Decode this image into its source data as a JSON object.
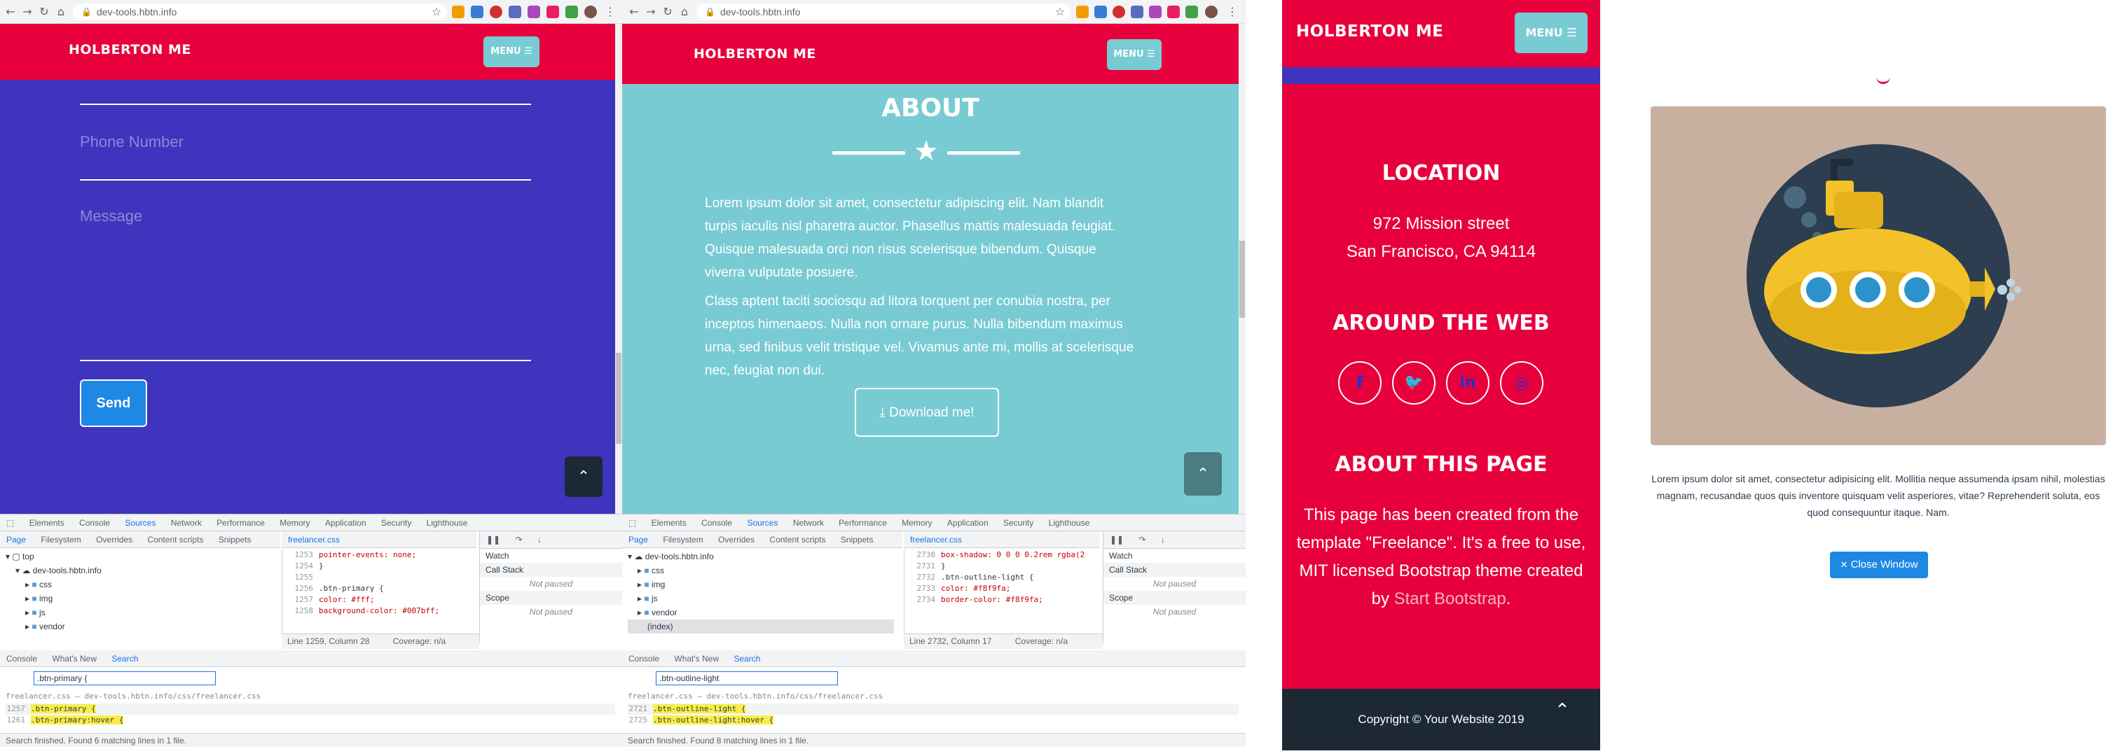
{
  "colors": {
    "red": "#e8003d",
    "indigo": "#3e34be",
    "teal": "#79cbd3",
    "dark_footer": "#1c2833",
    "send_blue": "#1e88e5",
    "modal_btn": "#1e88e5",
    "modal_img_bg": "#c8b0a0"
  },
  "browser1": {
    "url": "dev-tools.hbtn.info",
    "brand": "HOLBERTON ME",
    "menu": "MENU ☰",
    "phone_placeholder": "Phone Number",
    "message_placeholder": "Message",
    "send": "Send",
    "scroll_top": "⌃",
    "devtools": {
      "tabs": [
        "Elements",
        "Console",
        "Sources",
        "Network",
        "Performance",
        "Memory",
        "Application",
        "Security",
        "Lighthouse"
      ],
      "active_tab": "Sources",
      "nav_tabs": [
        "Page",
        "Filesystem",
        "Overrides",
        "Content scripts",
        "Snippets"
      ],
      "tree": [
        "top",
        "dev-tools.hbtn.info",
        "css",
        "img",
        "js",
        "vendor"
      ],
      "file_tab": "freelancer.css",
      "code": [
        {
          "n": "1253",
          "t": "pointer-events: none;"
        },
        {
          "n": "1254",
          "t": "}"
        },
        {
          "n": "1255",
          "t": ""
        },
        {
          "n": "1256",
          "t": ".btn-primary {"
        },
        {
          "n": "1257",
          "t": "color: #fff;"
        },
        {
          "n": "1258",
          "t": "background-color: #007bff;"
        }
      ],
      "right_panels": [
        "Watch",
        "Call Stack",
        "Not paused",
        "Scope",
        "Not paused"
      ],
      "status": "Line 1259, Column 28",
      "coverage": "Coverage: n/a",
      "drawer_tabs": [
        "Console",
        "What's New",
        "Search"
      ],
      "search_value": ".btn-primary {",
      "results_file": "freelancer.css — dev-tools.hbtn.info/css/freelancer.css",
      "results": [
        {
          "n": "1257",
          "t": ".btn-primary {"
        },
        {
          "n": "1261",
          "t": ".btn-primary:hover {"
        }
      ],
      "search_status": "Search finished. Found 6 matching lines in 1 file."
    }
  },
  "browser2": {
    "url": "dev-tools.hbtn.info",
    "brand": "HOLBERTON ME",
    "menu": "MENU ☰",
    "about_title": "ABOUT",
    "para1": "Lorem ipsum dolor sit amet, consectetur adipiscing elit. Nam blandit turpis iaculis nisl pharetra auctor. Phasellus mattis malesuada feugiat. Quisque malesuada orci non risus scelerisque bibendum. Quisque viverra vulputate posuere.",
    "para2": "Class aptent taciti sociosqu ad litora torquent per conubia nostra, per inceptos himenaeos. Nulla non ornare purus. Nulla bibendum maximus urna, sed finibus velit tristique vel. Vivamus ante mi, mollis at scelerisque nec, feugiat non dui.",
    "download": "Download me!",
    "scroll_top": "⌃",
    "devtools": {
      "tabs": [
        "Elements",
        "Console",
        "Sources",
        "Network",
        "Performance",
        "Memory",
        "Application",
        "Security",
        "Lighthouse"
      ],
      "active_tab": "Sources",
      "nav_tabs": [
        "Page",
        "Filesystem",
        "Overrides",
        "Content scripts",
        "Snippets"
      ],
      "tree": [
        "dev-tools.hbtn.info",
        "css",
        "img",
        "js",
        "vendor",
        "(index)"
      ],
      "file_tab": "freelancer.css",
      "code": [
        {
          "n": "2730",
          "t": "box-shadow: 0 0 0 0.2rem rgba(2"
        },
        {
          "n": "2731",
          "t": "}"
        },
        {
          "n": "2732",
          "t": ".btn-outline-light {"
        },
        {
          "n": "2733",
          "t": "color: #f8f9fa;"
        },
        {
          "n": "2734",
          "t": "border-color: #f8f9fa;"
        }
      ],
      "right_panels": [
        "Watch",
        "Call Stack",
        "Not paused",
        "Scope",
        "Not paused"
      ],
      "status": "Line 2732, Column 17",
      "coverage": "Coverage: n/a",
      "drawer_tabs": [
        "Console",
        "What's New",
        "Search"
      ],
      "search_value": ".btn-outline-light",
      "results_file": "freelancer.css — dev-tools.hbtn.info/css/freelancer.css",
      "results": [
        {
          "n": "2721",
          "t": ".btn-outline-light {"
        },
        {
          "n": "2725",
          "t": ".btn-outline-light:hover {"
        }
      ],
      "search_status": "Search finished. Found 8 matching lines in 1 file."
    }
  },
  "mobile": {
    "brand": "HOLBERTON ME",
    "menu": "MENU ☰",
    "location_title": "LOCATION",
    "address1": "972 Mission street",
    "address2": "San Francisco, CA 94114",
    "web_title": "AROUND THE WEB",
    "socials": [
      "facebook-icon",
      "twitter-icon",
      "linkedin-icon",
      "dribbble-icon"
    ],
    "about_title": "ABOUT THIS PAGE",
    "about_text_1": "This page has been created from the template \"Freelance\". It's a free to use, MIT licensed Bootstrap theme created by ",
    "about_link": "Start Bootstrap",
    "about_text_2": ".",
    "copyright": "Copyright © Your Website 2019",
    "scroll_top": "⌃"
  },
  "modal": {
    "text": "Lorem ipsum dolor sit amet, consectetur adipisicing elit. Mollitia neque assumenda ipsam nihil, molestias magnam, recusandae quos quis inventore quisquam velit asperiores, vitae? Reprehenderit soluta, eos quod consequuntur itaque. Nam.",
    "close": "Close Window",
    "close_icon": "✕"
  }
}
